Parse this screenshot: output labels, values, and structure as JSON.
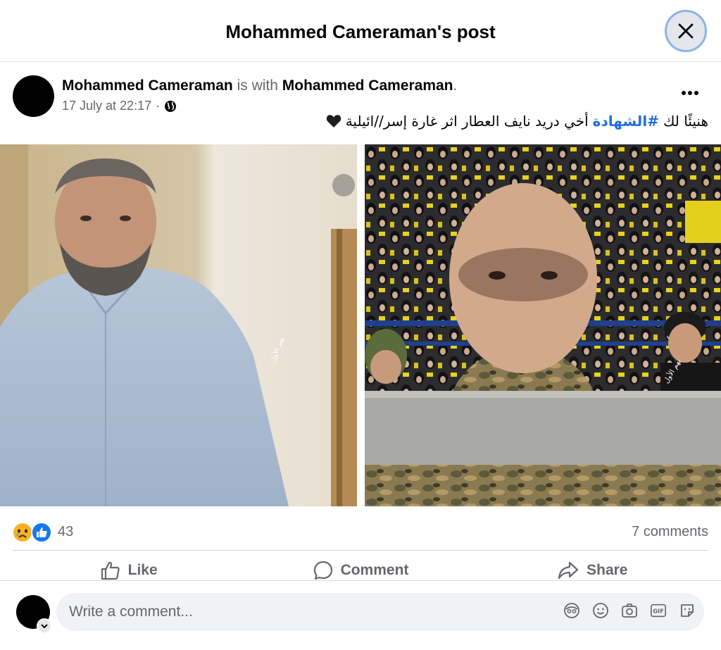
{
  "header": {
    "title": "Mohammed Cameraman's post",
    "close_icon": "close-icon"
  },
  "post": {
    "author": "Mohammed Cameraman",
    "with_text": " is with ",
    "tagged": "Mohammed Cameraman",
    "tagged_suffix": ".",
    "timestamp": "17 July at 22:17",
    "separator": " · ",
    "privacy_icon": "globe-icon",
    "caption_before": "هنيئًا لك ",
    "caption_hashtag": "#الشهادة",
    "caption_after": " أخي دريد نايف العطار اثر غارة إسر//ائيلية",
    "caption_emoji": "black-heart",
    "photos": [
      "bearded-man-blue-shirt",
      "masked-man-crowd-yellow-flags"
    ]
  },
  "stats": {
    "reaction_icons": [
      "sad-reaction-icon",
      "like-reaction-icon"
    ],
    "reaction_count": "43",
    "comments": "7 comments"
  },
  "actions": {
    "like": "Like",
    "comment": "Comment",
    "share": "Share"
  },
  "composer": {
    "placeholder": "Write a comment...",
    "icons": [
      "avatar-sticker-icon",
      "emoji-icon",
      "camera-icon",
      "gif-icon",
      "sticker-icon"
    ]
  },
  "colors": {
    "hashtag": "#216fdb",
    "muted": "#65676b",
    "like_blue": "#1877f2",
    "sad_yellow": "#f7b125"
  }
}
